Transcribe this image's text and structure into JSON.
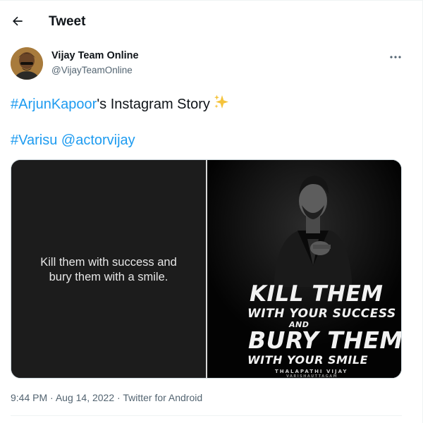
{
  "header": {
    "back_icon": "arrow-left-icon",
    "title": "Tweet"
  },
  "author": {
    "name": "Vijay Team Online",
    "handle": "@VijayTeamOnline",
    "more_icon": "more-horizontal-icon"
  },
  "tweet": {
    "line1": {
      "hashtag": "#ArjunKapoor",
      "text": "'s Instagram Story",
      "emoji_icon": "sparkles-icon"
    },
    "line2": {
      "hashtag": "#Varisu",
      "mention": "@actorvijay"
    }
  },
  "media": {
    "left_quote": [
      "Kill them with success and",
      "bury them with a smile."
    ],
    "poster": {
      "line1": "KILL THEM",
      "line2": "WITH YOUR SUCCESS",
      "line3": "AND",
      "line4": "BURY THEM",
      "line5": "WITH YOUR SMILE",
      "signature": "THALAPATHI VIJAY",
      "credit": "VARISHAUTTAGAM"
    }
  },
  "meta": {
    "time": "9:44 PM",
    "date": "Aug 14, 2022",
    "separator": "·",
    "source": "Twitter for Android"
  },
  "colors": {
    "link": "#1d9bf0",
    "text": "#0f1419",
    "secondary": "#536471"
  }
}
